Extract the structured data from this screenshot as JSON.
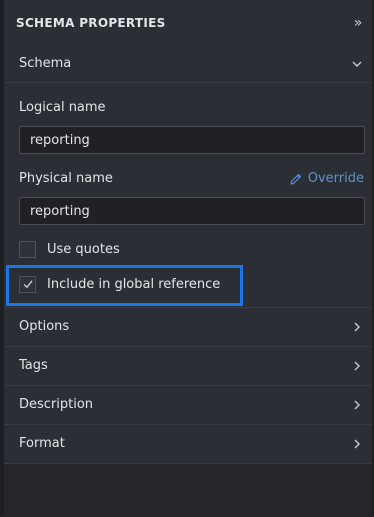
{
  "header": {
    "title": "SCHEMA PROPERTIES",
    "collapse_icon": "double-chevron-right-icon"
  },
  "schema_section": {
    "label": "Schema",
    "expanded": true,
    "logical_name": {
      "label": "Logical name",
      "value": "reporting"
    },
    "physical_name": {
      "label": "Physical name",
      "value": "reporting",
      "override_label": "Override"
    },
    "use_quotes": {
      "label": "Use quotes",
      "checked": false
    },
    "include_global": {
      "label": "Include in global reference",
      "checked": true
    }
  },
  "sections": [
    {
      "label": "Options"
    },
    {
      "label": "Tags"
    },
    {
      "label": "Description"
    },
    {
      "label": "Format"
    }
  ],
  "colors": {
    "accent": "#5b93cf",
    "highlight": "#1a75e8",
    "background": "#24262b"
  }
}
